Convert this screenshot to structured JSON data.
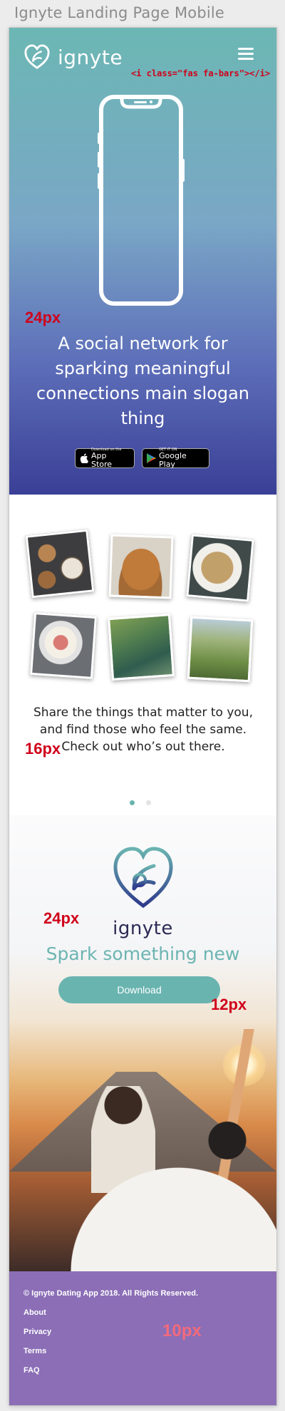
{
  "page_title": "Ignyte Landing Page Mobile",
  "colors": {
    "teal": "#6ab4b0",
    "purple_footer": "#8b6eb6",
    "hero_top": "#6cb7b4",
    "hero_bottom": "#3a3f96",
    "navy_text": "#2d2b55",
    "annotation_red": "#d0021b"
  },
  "nav": {
    "logo_text": "ignyte",
    "logo_icon": "heart-logo-icon",
    "menu_icon": "hamburger-menu-icon",
    "menu_annotation": "<i class=\"fas fa-bars\"></i>"
  },
  "hero": {
    "spacing_annotation": "24px",
    "headline": "A social network for sparking meaningful connections main slogan thing",
    "app_store": {
      "small": "Download on the",
      "big": "App Store"
    },
    "google_play": {
      "small": "GET IT ON",
      "big": "Google Play"
    }
  },
  "gallery": {
    "photos": [
      "cookies-and-coffee",
      "dog",
      "noodle-dish",
      "smoothie-bowl",
      "hikers",
      "mountain-trail"
    ],
    "caption": "Share the things that matter to you, and find those who feel the same. Check out who’s out there.",
    "font_annotation": "16px",
    "carousel_active_index": 0,
    "carousel_count": 2
  },
  "cta": {
    "logo_text": "ignyte",
    "spacing_annotation": "24px",
    "slogan": "Spark something new",
    "download_label": "Download",
    "button_annotation": "12px"
  },
  "footer": {
    "copyright": "© Ignyte Dating App 2018. All Rights Reserved.",
    "links": [
      "About",
      "Privacy",
      "Terms",
      "FAQ"
    ],
    "font_annotation": "10px"
  }
}
